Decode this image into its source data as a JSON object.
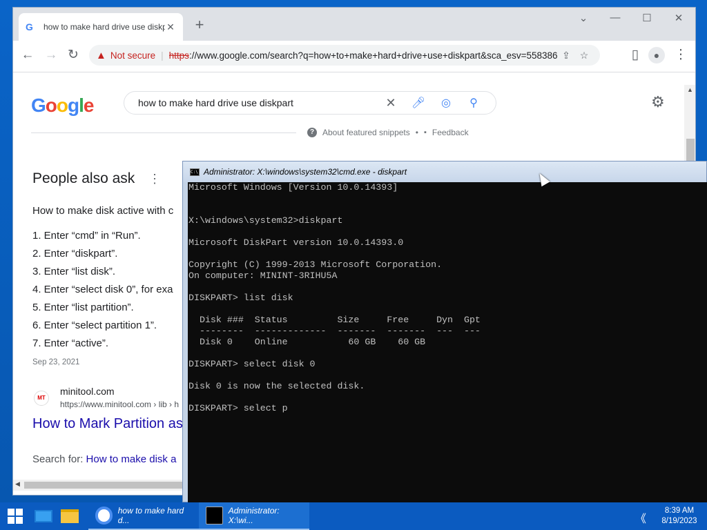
{
  "browser": {
    "tab_title": "how to make hard drive use diskp",
    "new_tab": "+",
    "window_controls": {
      "dropdown": "⌄",
      "minimize": "—",
      "maximize": "☐",
      "close": "✕"
    },
    "not_secure": "Not secure",
    "url_scheme": "https",
    "url_rest": "://www.google.com/search?q=how+to+make+hard+drive+use+diskpart&sca_esv=558386..."
  },
  "google": {
    "logo_letters": [
      "G",
      "o",
      "o",
      "g",
      "l",
      "e"
    ],
    "logo_colors": [
      "#4285f4",
      "#ea4335",
      "#fbbc05",
      "#4285f4",
      "#34a853",
      "#ea4335"
    ],
    "query": "how to make hard drive use diskpart",
    "about_snippets": "About featured snippets",
    "dot": "•",
    "feedback": "Feedback",
    "people_also_ask": "People also ask",
    "answer_intro": "How to make disk active with c",
    "steps": [
      "1. Enter “cmd” in “Run”.",
      "2. Enter “diskpart”.",
      "3. Enter “list disk”.",
      "4. Enter “select disk 0”, for exa",
      "5. Enter “list partition”.",
      "6. Enter “select partition 1”.",
      "7. Enter “active”."
    ],
    "date": "Sep 23, 2021",
    "favicon_text": "MT",
    "site_name": "minitool.com",
    "site_url": "https://www.minitool.com › lib › h",
    "result_title": "How to Mark Partition as",
    "search_for_label": "Search for: ",
    "search_for_link": "How to make disk a"
  },
  "cmd": {
    "title": "Administrator: X:\\windows\\system32\\cmd.exe - diskpart",
    "icon_text": "C:\\",
    "lines": [
      "Microsoft Windows [Version 10.0.14393]",
      "",
      "",
      "X:\\windows\\system32>diskpart",
      "",
      "Microsoft DiskPart version 10.0.14393.0",
      "",
      "Copyright (C) 1999-2013 Microsoft Corporation.",
      "On computer: MININT-3RIHU5A",
      "",
      "DISKPART> list disk",
      "",
      "  Disk ###  Status         Size     Free     Dyn  Gpt",
      "  --------  -------------  -------  -------  ---  ---",
      "  Disk 0    Online           60 GB    60 GB",
      "",
      "DISKPART> select disk 0",
      "",
      "Disk 0 is now the selected disk.",
      "",
      "DISKPART> select p"
    ]
  },
  "taskbar": {
    "app1_label": "how to make hard d...",
    "app2_label": "Administrator: X:\\wi...",
    "tray_arrow": "《",
    "time": "8:39 AM",
    "date": "8/19/2023"
  }
}
